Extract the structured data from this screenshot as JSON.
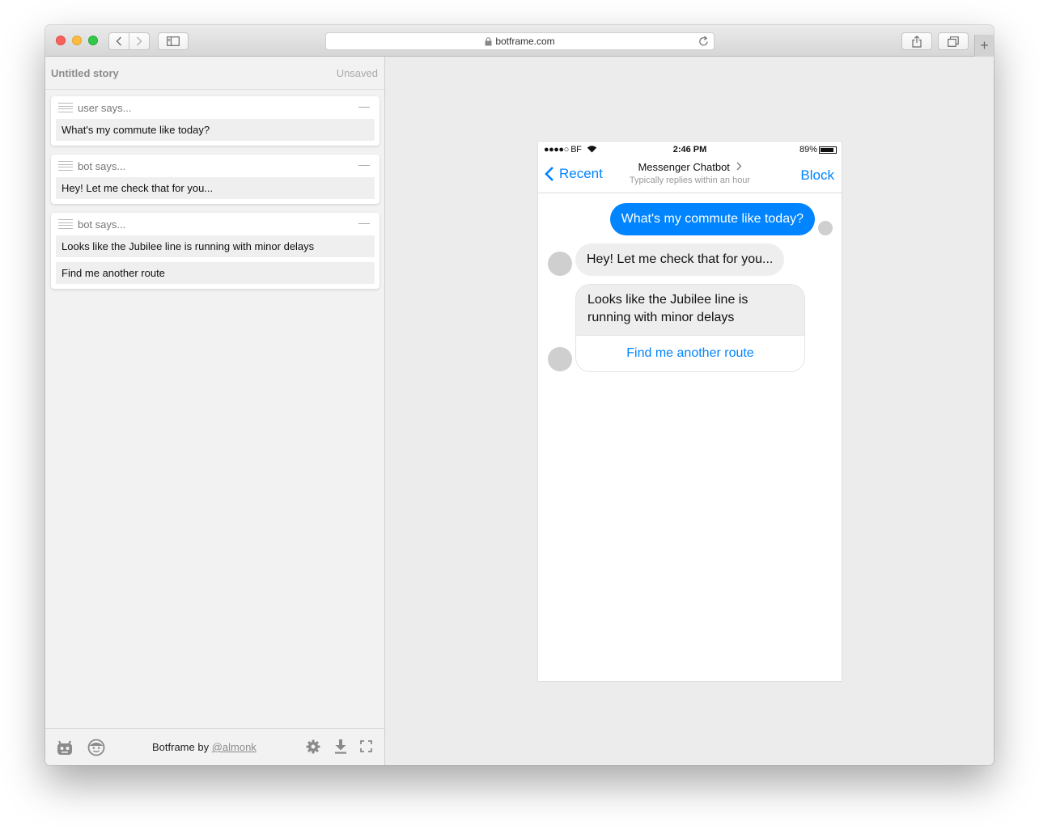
{
  "browser": {
    "url": "botframe.com",
    "icons": [
      "back-icon",
      "forward-icon",
      "sidebar-icon",
      "lock-icon",
      "reload-icon",
      "share-icon",
      "tabs-icon",
      "plus-icon"
    ],
    "new_tab_label": "+"
  },
  "editor": {
    "story_title": "Untitled story",
    "save_status": "Unsaved",
    "cards": [
      {
        "label": "user says...",
        "fields": [
          "What's my commute like today?"
        ]
      },
      {
        "label": "bot says...",
        "fields": [
          "Hey! Let me check that for you..."
        ]
      },
      {
        "label": "bot says...",
        "fields": [
          "Looks like the Jubilee line is running with minor delays",
          "Find me another route"
        ]
      }
    ],
    "footer": {
      "credit_prefix": "Botframe by ",
      "credit_link": "@almonk",
      "icons": [
        "bot-icon",
        "user-face-icon",
        "gear-icon",
        "download-icon",
        "fullscreen-icon"
      ]
    }
  },
  "phone": {
    "status": {
      "carrier": "●●●●○ BF",
      "time": "2:46 PM",
      "battery": "89%",
      "battery_level": 0.89
    },
    "nav": {
      "back_label": "Recent",
      "title": "Messenger Chatbot",
      "subtitle": "Typically replies within an hour",
      "block_label": "Block"
    },
    "messages": {
      "user_message": "What's my commute like today?",
      "bot_message": "Hey! Let me check that for you...",
      "bot_card_text": "Looks like the Jubilee line is running with minor delays",
      "bot_card_button": "Find me another route"
    }
  },
  "colors": {
    "messenger_blue": "#0084ff",
    "bubble_gray": "#eeeeee"
  }
}
